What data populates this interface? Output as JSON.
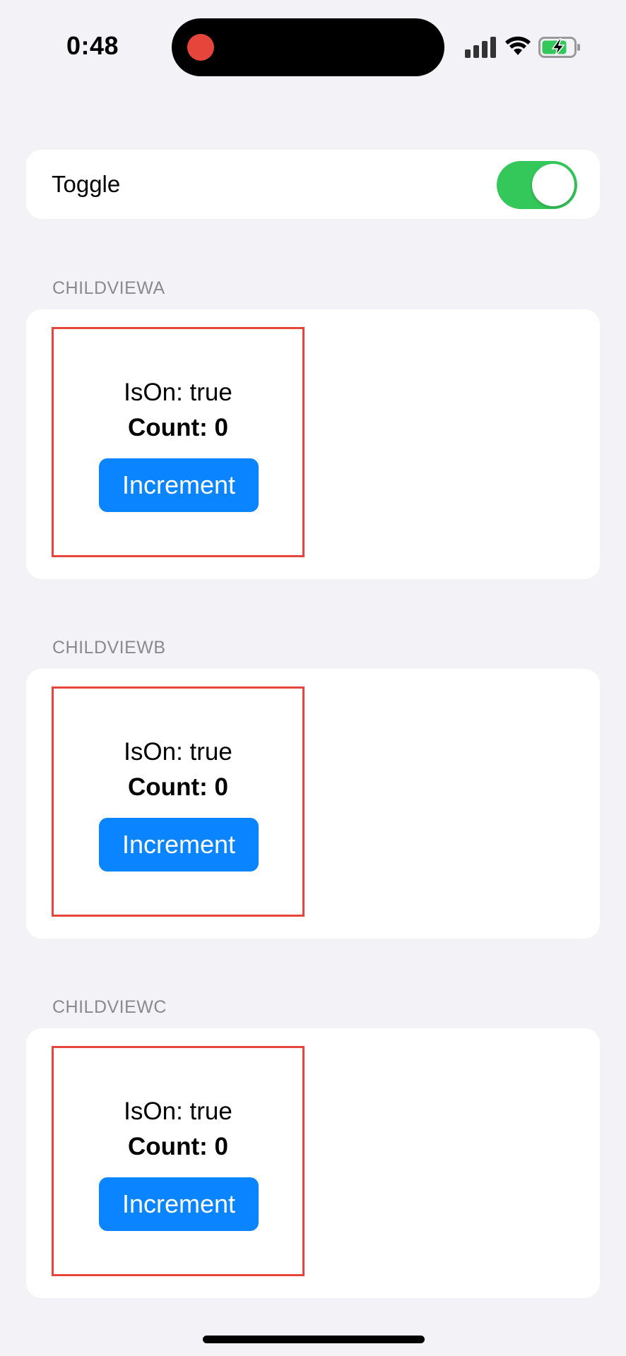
{
  "status_bar": {
    "time": "0:48"
  },
  "toggle_row": {
    "label": "Toggle",
    "is_on": true
  },
  "sections": [
    {
      "header": "CHILDVIEWA",
      "ison_text": "IsOn: true",
      "count_text": "Count: 0",
      "button_label": "Increment"
    },
    {
      "header": "CHILDVIEWB",
      "ison_text": "IsOn: true",
      "count_text": "Count: 0",
      "button_label": "Increment"
    },
    {
      "header": "CHILDVIEWC",
      "ison_text": "IsOn: true",
      "count_text": "Count: 0",
      "button_label": "Increment"
    }
  ],
  "colors": {
    "background": "#f2f2f7",
    "toggle_on": "#34c759",
    "button": "#0a84ff",
    "border": "#e5453a",
    "section_header": "#8a8a8e"
  }
}
